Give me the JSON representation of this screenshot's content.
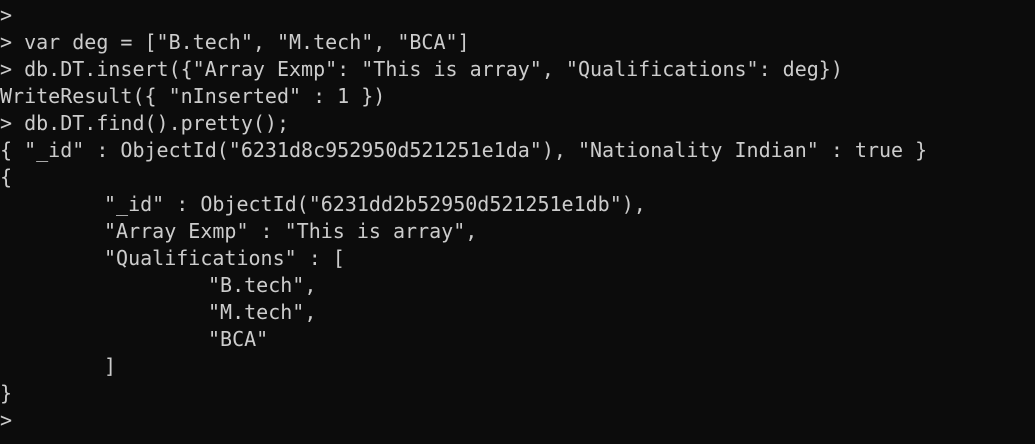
{
  "terminal": {
    "lines": [
      {
        "text": ">"
      },
      {
        "text": "> var deg = [\"B.tech\", \"M.tech\", \"BCA\"]"
      },
      {
        "text": "> db.DT.insert({\"Array Exmp\": \"This is array\", \"Qualifications\": deg})"
      },
      {
        "text": "WriteResult({ \"nInserted\" : 1 })"
      },
      {
        "text": "> db.DT.find().pretty();"
      },
      {
        "text": "{ \"_id\" : ObjectId(\"6231d8c952950d521251e1da\"), \"Nationality Indian\" : true }"
      },
      {
        "text": "{"
      },
      {
        "text": "\"_id\" : ObjectId(\"6231dd2b52950d521251e1db\"),"
      },
      {
        "text": "\"Array Exmp\" : \"This is array\","
      },
      {
        "text": "\"Qualifications\" : ["
      },
      {
        "text": "\"B.tech\","
      },
      {
        "text": "\"M.tech\","
      },
      {
        "text": "\"BCA\""
      },
      {
        "text": "]"
      },
      {
        "text": "}"
      },
      {
        "text": ">"
      }
    ]
  }
}
